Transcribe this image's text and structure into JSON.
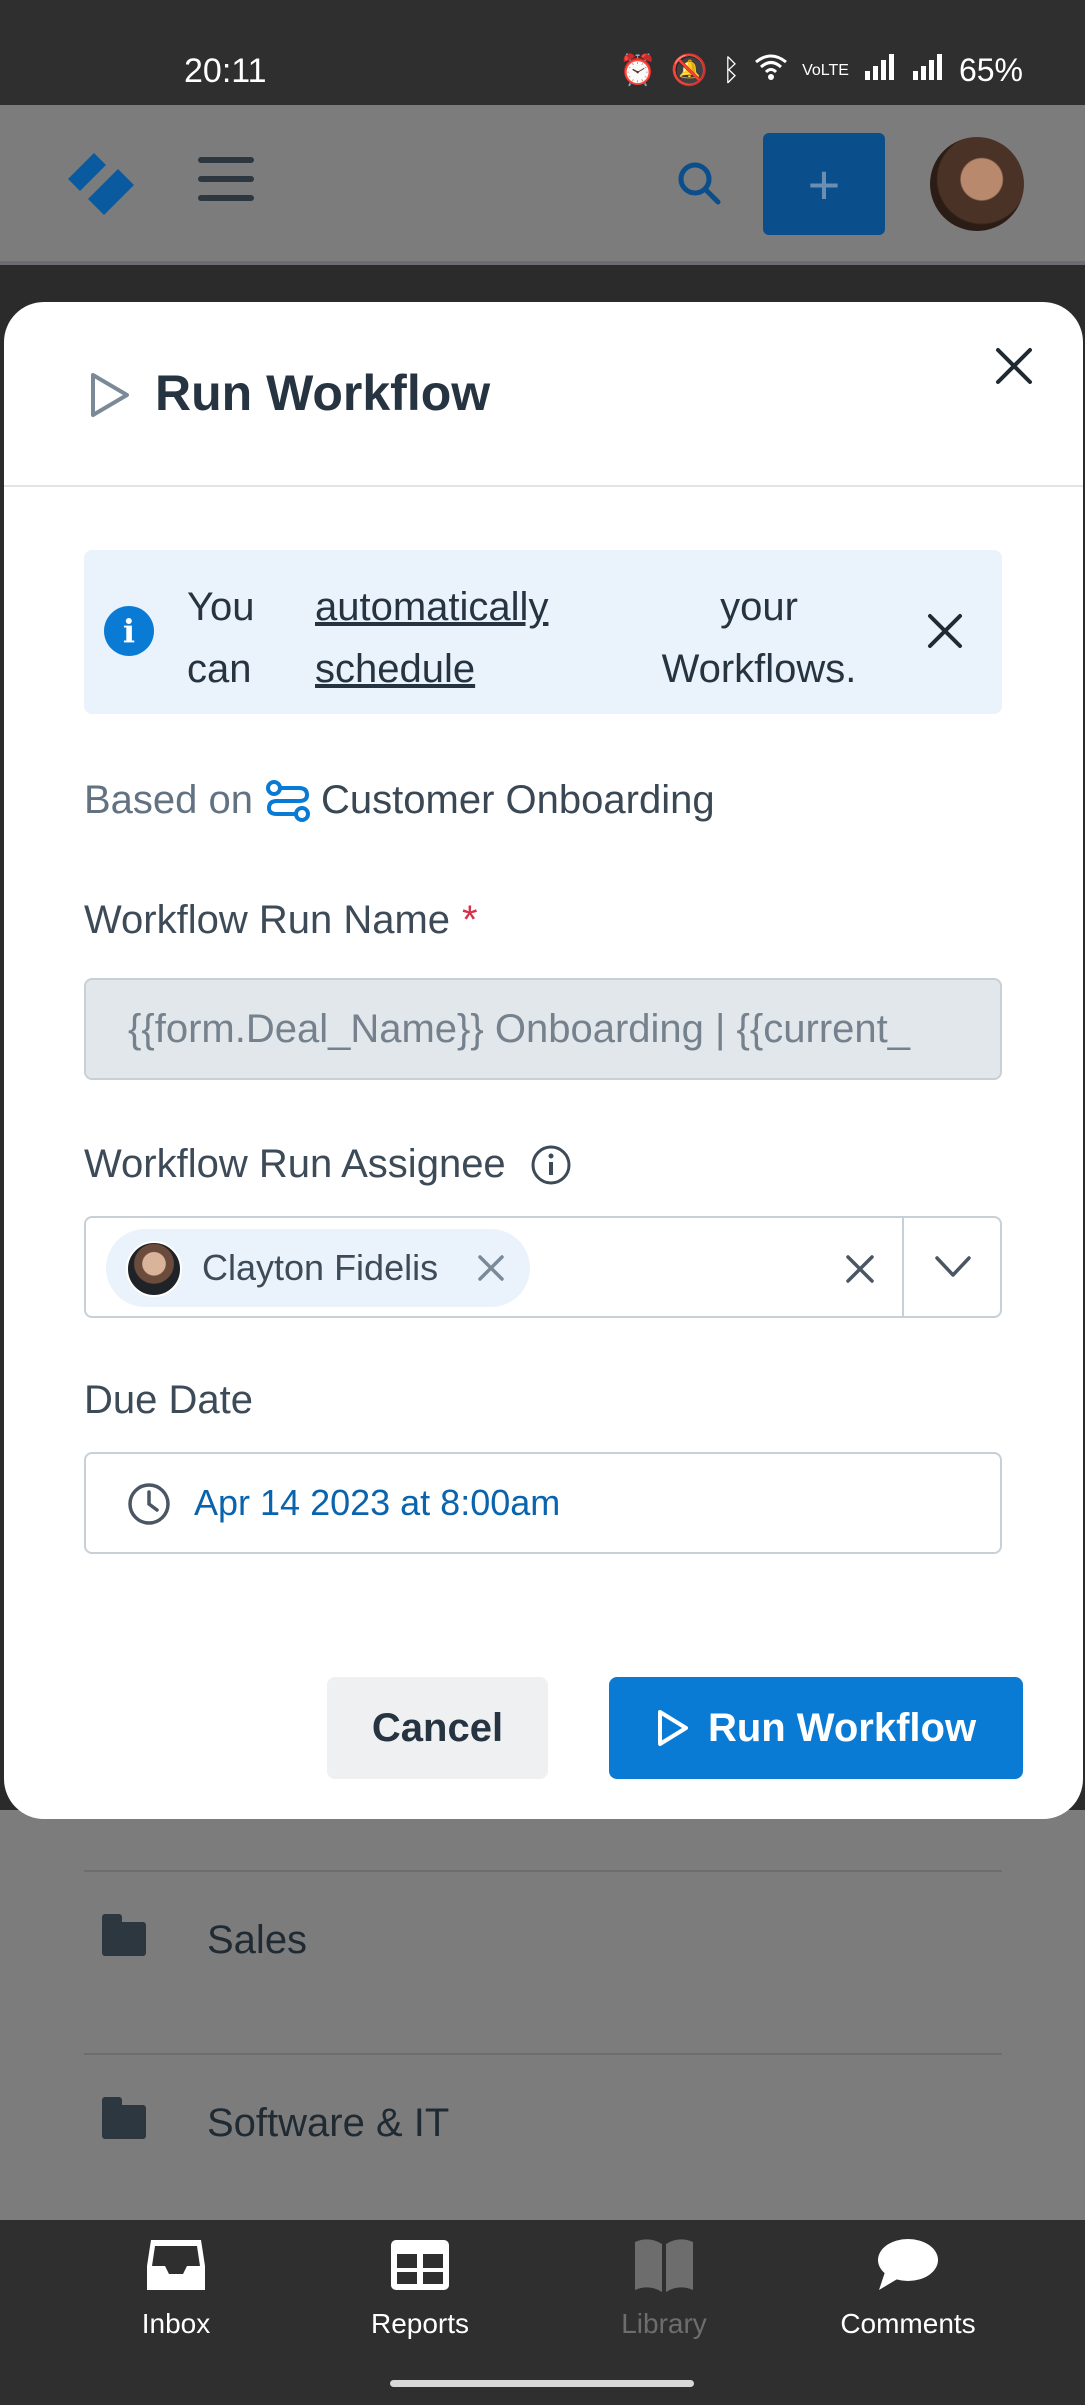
{
  "status_bar": {
    "time": "20:11",
    "battery": "65%",
    "indicator_icons": [
      "alarm-icon",
      "mute-icon",
      "bluetooth-icon",
      "wifi-icon",
      "volte-icon",
      "signal-icon",
      "signal-icon"
    ]
  },
  "header": {
    "add_label": "+",
    "accent_color": "#0a4e8c"
  },
  "modal": {
    "title": "Run Workflow",
    "banner": {
      "part1": "You can",
      "link": "automatically schedule",
      "part2": "your Workflows."
    },
    "based_on_label": "Based on",
    "based_on_workflow": "Customer Onboarding",
    "run_name_label": "Workflow Run Name",
    "required_marker": "*",
    "run_name_value": "{{form.Deal_Name}} Onboarding | {{current_",
    "assignee_label": "Workflow Run Assignee",
    "assignee_name": "Clayton Fidelis",
    "due_date_label": "Due Date",
    "due_date_value": "Apr 14 2023 at 8:00am",
    "cancel_label": "Cancel",
    "run_label": "Run Workflow",
    "primary_color": "#0a7bd4"
  },
  "background_list": {
    "items": [
      "Sales",
      "Software & IT"
    ]
  },
  "bottom_nav": {
    "items": [
      {
        "label": "Inbox",
        "icon": "inbox-icon"
      },
      {
        "label": "Reports",
        "icon": "reports-icon"
      },
      {
        "label": "Library",
        "icon": "library-icon"
      },
      {
        "label": "Comments",
        "icon": "comments-icon"
      }
    ]
  }
}
